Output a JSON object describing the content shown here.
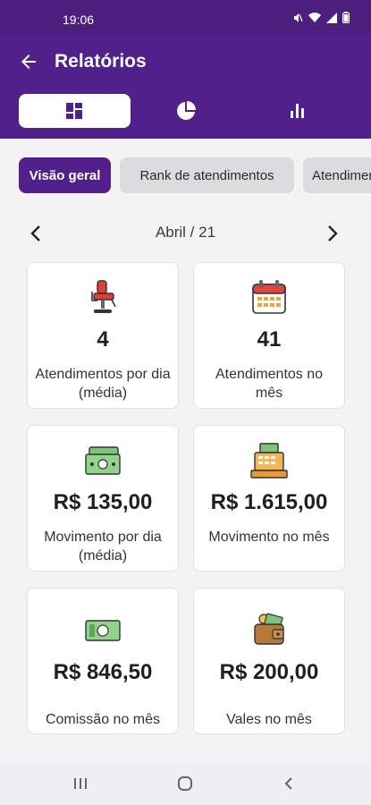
{
  "status": {
    "time": "19:06",
    "battery": ""
  },
  "header": {
    "title": "Relatórios"
  },
  "view_tabs": [
    {
      "name": "grid-view-icon",
      "active": true
    },
    {
      "name": "pie-chart-icon",
      "active": false
    },
    {
      "name": "bar-chart-icon",
      "active": false
    }
  ],
  "chips": [
    {
      "label": "Visão geral",
      "active": true
    },
    {
      "label": "Rank de atendimentos",
      "active": false
    },
    {
      "label": "Atendimentos",
      "active": false
    }
  ],
  "month": {
    "label": "Abril / 21"
  },
  "cards": [
    {
      "icon": "barber-chair-icon",
      "value": "4",
      "label": "Atendimentos por dia (média)"
    },
    {
      "icon": "calendar-icon",
      "value": "41",
      "label": "Atendimentos no mês"
    },
    {
      "icon": "money-bills-icon",
      "value": "R$ 135,00",
      "label": "Movimento por dia (média)"
    },
    {
      "icon": "cash-register-icon",
      "value": "R$ 1.615,00",
      "label": "Movimento no mês"
    },
    {
      "icon": "banknote-icon",
      "value": "R$ 846,50",
      "label": "Comissão no mês"
    },
    {
      "icon": "wallet-icon",
      "value": "R$ 200,00",
      "label": "Vales no mês"
    }
  ],
  "colors": {
    "primary": "#51208a",
    "background": "#f3f2f5",
    "chip_inactive": "#dcdbe0"
  }
}
